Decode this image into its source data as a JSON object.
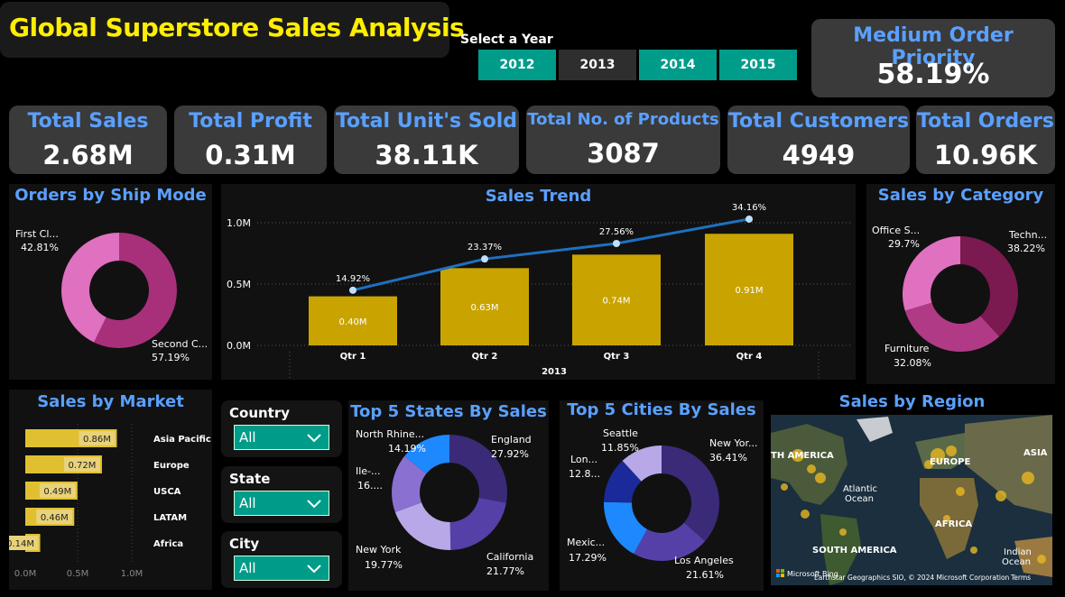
{
  "title": "Global Superstore Sales Analysis",
  "year_selector": {
    "label": "Select a Year",
    "years": [
      {
        "label": "2012",
        "selected": true
      },
      {
        "label": "2013",
        "selected": false
      },
      {
        "label": "2014",
        "selected": true
      },
      {
        "label": "2015",
        "selected": true
      }
    ]
  },
  "priority_card": {
    "label": "Medium Order Priority",
    "value": "58.19%"
  },
  "kpis": [
    {
      "label": "Total Sales",
      "value": "2.68M"
    },
    {
      "label": "Total Profit",
      "value": "0.31M"
    },
    {
      "label": "Total Unit's Sold",
      "value": "38.11K"
    },
    {
      "label": "Total No. of Products",
      "value": "3087"
    },
    {
      "label": "Total Customers",
      "value": "4949"
    },
    {
      "label": "Total Orders",
      "value": "10.96K"
    }
  ],
  "colors": {
    "accent_blue": "#5aa0ff",
    "title_yellow": "#ffee00",
    "bar_gold": "#c9a400",
    "teal": "#009c8a",
    "card_grey": "#3a3a3a"
  },
  "chart_data": [
    {
      "type": "pie",
      "title": "Orders by Ship Mode",
      "slices": [
        {
          "label": "First Cl...",
          "value": 42.81,
          "display": "42.81%",
          "color": "#e070c0"
        },
        {
          "label": "Second C...",
          "value": 57.19,
          "display": "57.19%",
          "color": "#a8307a"
        }
      ]
    },
    {
      "type": "bar",
      "title": "Sales Trend",
      "categories": [
        "Qtr 1",
        "Qtr 2",
        "Qtr 3",
        "Qtr 4"
      ],
      "x_group_label": "2013",
      "values": [
        0.4,
        0.63,
        0.74,
        0.91
      ],
      "value_labels": [
        "0.40M",
        "0.63M",
        "0.74M",
        "0.91M"
      ],
      "line_values": [
        14.92,
        23.37,
        27.56,
        34.16
      ],
      "line_labels": [
        "14.92%",
        "23.37%",
        "27.56%",
        "34.16%"
      ],
      "yticks": [
        "0.0M",
        "0.5M",
        "1.0M"
      ],
      "ylim": [
        0,
        1.1
      ]
    },
    {
      "type": "pie",
      "title": "Sales by Category",
      "slices": [
        {
          "label": "Techn...",
          "value": 38.22,
          "display": "38.22%",
          "color": "#7a1a50"
        },
        {
          "label": "Furniture",
          "value": 32.08,
          "display": "32.08%",
          "color": "#b03a85"
        },
        {
          "label": "Office S...",
          "value": 29.7,
          "display": "29.7%",
          "color": "#e070c0"
        }
      ]
    },
    {
      "type": "bar",
      "title": "Sales by Market",
      "categories": [
        "Asia Pacific",
        "Europe",
        "USCA",
        "LATAM",
        "Africa"
      ],
      "values": [
        0.86,
        0.72,
        0.49,
        0.46,
        0.14
      ],
      "value_labels": [
        "0.86M",
        "0.72M",
        "0.49M",
        "0.46M",
        "0.14M"
      ],
      "xticks": [
        "0.0M",
        "0.5M",
        "1.0M"
      ],
      "xlim": [
        0,
        1.0
      ]
    },
    {
      "type": "pie",
      "title": "Top 5 States By Sales",
      "slices": [
        {
          "label": "England",
          "value": 27.92,
          "display": "27.92%",
          "color": "#3b2a78"
        },
        {
          "label": "California",
          "value": 21.77,
          "display": "21.77%",
          "color": "#5540a8"
        },
        {
          "label": "New York",
          "value": 19.77,
          "display": "19.77%",
          "color": "#b8a8e8"
        },
        {
          "label": "Ile-...",
          "value": 16.35,
          "display": "16....",
          "color": "#8a70d0"
        },
        {
          "label": "North Rhine...",
          "value": 14.19,
          "display": "14.19%",
          "color": "#1e88ff"
        }
      ]
    },
    {
      "type": "pie",
      "title": "Top 5 Cities By Sales",
      "slices": [
        {
          "label": "New Yor...",
          "value": 36.41,
          "display": "36.41%",
          "color": "#3b2a78"
        },
        {
          "label": "Los Angeles",
          "value": 21.61,
          "display": "21.61%",
          "color": "#5540a8"
        },
        {
          "label": "Mexic...",
          "value": 17.29,
          "display": "17.29%",
          "color": "#1e88ff"
        },
        {
          "label": "Lon...",
          "value": 12.84,
          "display": "12.8...",
          "color": "#1a2a9a"
        },
        {
          "label": "Seattle",
          "value": 11.85,
          "display": "11.85%",
          "color": "#b8a8e8"
        }
      ]
    }
  ],
  "slicers": [
    {
      "label": "Country",
      "value": "All"
    },
    {
      "label": "State",
      "value": "All"
    },
    {
      "label": "City",
      "value": "All"
    }
  ],
  "map": {
    "title": "Sales by Region",
    "labels": [
      "TH AMERICA",
      "EUROPE",
      "ASIA",
      "Atlantic Ocean",
      "AFRICA",
      "SOUTH AMERICA",
      "Indian Ocean"
    ],
    "attribution": "Earthstar Geographics SIO, © 2024 Microsoft Corporation",
    "terms": "Terms",
    "logo": "Microsoft Bing"
  }
}
